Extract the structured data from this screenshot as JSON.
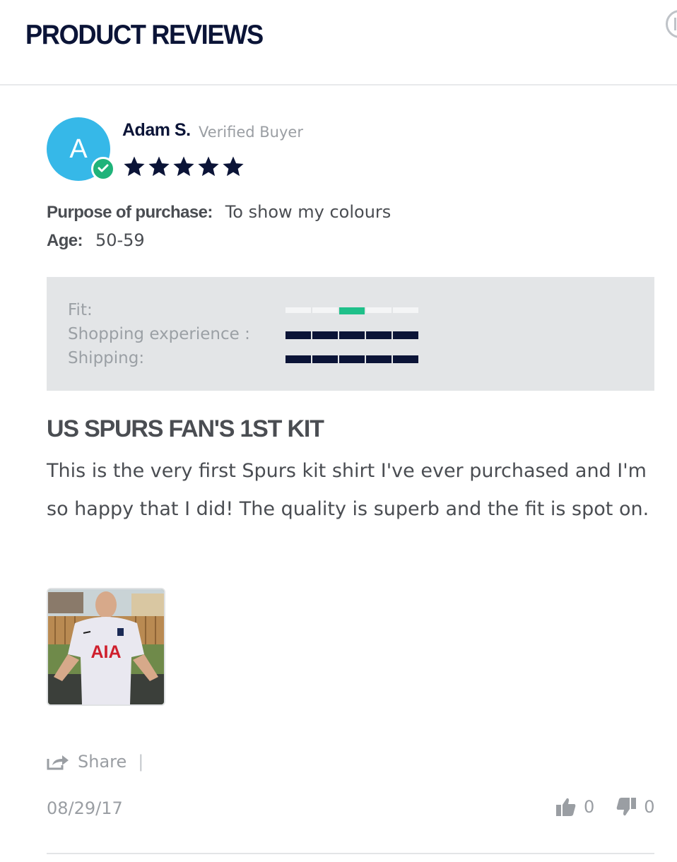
{
  "header": {
    "title": "PRODUCT REVIEWS"
  },
  "reviewer": {
    "initial": "A",
    "name": "Adam S.",
    "badge": "Verified Buyer",
    "rating": 5,
    "rating_max": 5
  },
  "meta": {
    "purpose_label": "Purpose of purchase:",
    "purpose_value": "To show my colours",
    "age_label": "Age:",
    "age_value": "50-59"
  },
  "ratings": [
    {
      "label": "Fit:",
      "level": 3,
      "max": 5,
      "style": "position"
    },
    {
      "label": "Shopping experience :",
      "level": 5,
      "max": 5,
      "style": "fill"
    },
    {
      "label": "Shipping:",
      "level": 5,
      "max": 5,
      "style": "fill"
    }
  ],
  "review": {
    "title": "US SPURS FAN'S 1ST KIT",
    "body": "This is the very first Spurs kit shirt I've ever purchased and I'm so happy that I did! The quality is superb and the fit is spot on.",
    "photo_shirt_text": "AIA"
  },
  "footer": {
    "share_label": "Share",
    "separator": "|",
    "date": "08/29/17",
    "helpful_count": "0",
    "unhelpful_count": "0"
  },
  "colors": {
    "navy": "#0b1437",
    "avatar": "#36b8e8",
    "verified": "#1fb37a",
    "fit_marker": "#1fc08a",
    "panel": "#e3e5e7"
  }
}
